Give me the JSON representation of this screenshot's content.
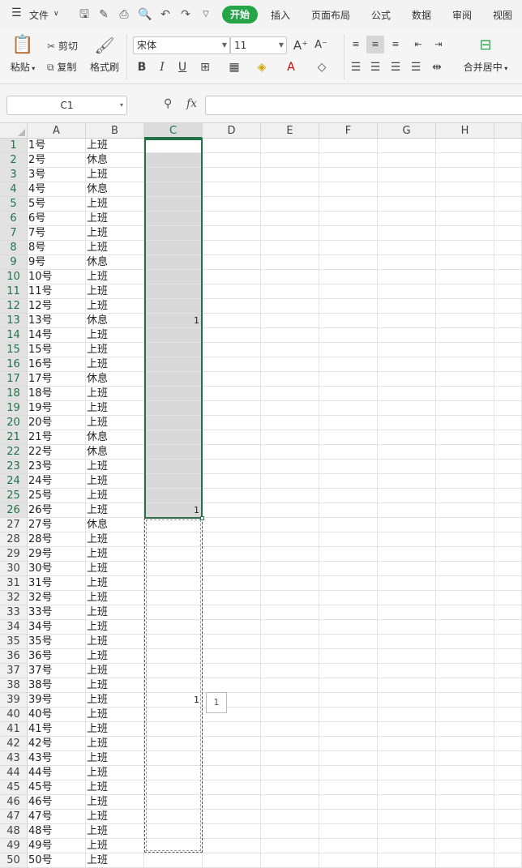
{
  "menu": {
    "file_label": "文件",
    "tabs": [
      "开始",
      "插入",
      "页面布局",
      "公式",
      "数据",
      "审阅",
      "视图"
    ],
    "active_tab": "开始"
  },
  "ribbon": {
    "paste": "粘贴",
    "cut": "剪切",
    "copy": "复制",
    "format_painter": "格式刷",
    "font_name": "宋体",
    "font_size": "11",
    "merge_center": "合并居中"
  },
  "formula_bar": {
    "name_box": "C1",
    "fx": "fx",
    "content": ""
  },
  "columns": [
    "A",
    "B",
    "C",
    "D",
    "E",
    "F",
    "G",
    "H"
  ],
  "rows": [
    {
      "n": "1",
      "a": "1号",
      "b": "上班",
      "c": ""
    },
    {
      "n": "2",
      "a": "2号",
      "b": "休息",
      "c": ""
    },
    {
      "n": "3",
      "a": "3号",
      "b": "上班",
      "c": ""
    },
    {
      "n": "4",
      "a": "4号",
      "b": "休息",
      "c": ""
    },
    {
      "n": "5",
      "a": "5号",
      "b": "上班",
      "c": ""
    },
    {
      "n": "6",
      "a": "6号",
      "b": "上班",
      "c": ""
    },
    {
      "n": "7",
      "a": "7号",
      "b": "上班",
      "c": ""
    },
    {
      "n": "8",
      "a": "8号",
      "b": "上班",
      "c": ""
    },
    {
      "n": "9",
      "a": "9号",
      "b": "休息",
      "c": ""
    },
    {
      "n": "10",
      "a": "10号",
      "b": "上班",
      "c": ""
    },
    {
      "n": "11",
      "a": "11号",
      "b": "上班",
      "c": ""
    },
    {
      "n": "12",
      "a": "12号",
      "b": "上班",
      "c": ""
    },
    {
      "n": "13",
      "a": "13号",
      "b": "休息",
      "c": "1"
    },
    {
      "n": "14",
      "a": "14号",
      "b": "上班",
      "c": ""
    },
    {
      "n": "15",
      "a": "15号",
      "b": "上班",
      "c": ""
    },
    {
      "n": "16",
      "a": "16号",
      "b": "上班",
      "c": ""
    },
    {
      "n": "17",
      "a": "17号",
      "b": "休息",
      "c": ""
    },
    {
      "n": "18",
      "a": "18号",
      "b": "上班",
      "c": ""
    },
    {
      "n": "19",
      "a": "19号",
      "b": "上班",
      "c": ""
    },
    {
      "n": "20",
      "a": "20号",
      "b": "上班",
      "c": ""
    },
    {
      "n": "21",
      "a": "21号",
      "b": "休息",
      "c": ""
    },
    {
      "n": "22",
      "a": "22号",
      "b": "休息",
      "c": ""
    },
    {
      "n": "23",
      "a": "23号",
      "b": "上班",
      "c": ""
    },
    {
      "n": "24",
      "a": "24号",
      "b": "上班",
      "c": ""
    },
    {
      "n": "25",
      "a": "25号",
      "b": "上班",
      "c": ""
    },
    {
      "n": "26",
      "a": "26号",
      "b": "上班",
      "c": "1"
    },
    {
      "n": "27",
      "a": "27号",
      "b": "休息",
      "c": ""
    },
    {
      "n": "28",
      "a": "28号",
      "b": "上班",
      "c": ""
    },
    {
      "n": "29",
      "a": "29号",
      "b": "上班",
      "c": ""
    },
    {
      "n": "30",
      "a": "30号",
      "b": "上班",
      "c": ""
    },
    {
      "n": "31",
      "a": "31号",
      "b": "上班",
      "c": ""
    },
    {
      "n": "32",
      "a": "32号",
      "b": "上班",
      "c": ""
    },
    {
      "n": "33",
      "a": "33号",
      "b": "上班",
      "c": ""
    },
    {
      "n": "34",
      "a": "34号",
      "b": "上班",
      "c": ""
    },
    {
      "n": "35",
      "a": "35号",
      "b": "上班",
      "c": ""
    },
    {
      "n": "36",
      "a": "36号",
      "b": "上班",
      "c": ""
    },
    {
      "n": "37",
      "a": "37号",
      "b": "上班",
      "c": ""
    },
    {
      "n": "38",
      "a": "38号",
      "b": "上班",
      "c": ""
    },
    {
      "n": "39",
      "a": "39号",
      "b": "上班",
      "c": "1"
    },
    {
      "n": "40",
      "a": "40号",
      "b": "上班",
      "c": ""
    },
    {
      "n": "41",
      "a": "41号",
      "b": "上班",
      "c": ""
    },
    {
      "n": "42",
      "a": "42号",
      "b": "上班",
      "c": ""
    },
    {
      "n": "43",
      "a": "43号",
      "b": "上班",
      "c": ""
    },
    {
      "n": "44",
      "a": "44号",
      "b": "上班",
      "c": ""
    },
    {
      "n": "45",
      "a": "45号",
      "b": "上班",
      "c": ""
    },
    {
      "n": "46",
      "a": "46号",
      "b": "上班",
      "c": ""
    },
    {
      "n": "47",
      "a": "47号",
      "b": "上班",
      "c": ""
    },
    {
      "n": "48",
      "a": "48号",
      "b": "上班",
      "c": ""
    },
    {
      "n": "49",
      "a": "49号",
      "b": "上班",
      "c": ""
    },
    {
      "n": "50",
      "a": "50号",
      "b": "上班",
      "c": ""
    }
  ],
  "autofill_tooltip": "1",
  "colors": {
    "accent": "#25a547",
    "selection_fill": "#d8d8d8",
    "selection_border": "#217346"
  }
}
